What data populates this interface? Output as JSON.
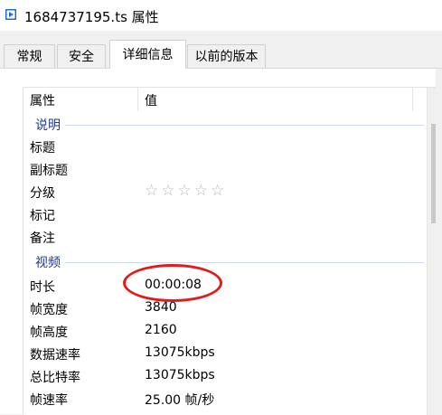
{
  "window": {
    "title": "1684737195.ts 属性",
    "icon": "video-file-icon"
  },
  "tabs": [
    {
      "label": "常规",
      "active": false
    },
    {
      "label": "安全",
      "active": false
    },
    {
      "label": "详细信息",
      "active": true
    },
    {
      "label": "以前的版本",
      "active": false
    }
  ],
  "details": {
    "columns": {
      "property": "属性",
      "value": "值"
    },
    "groups": {
      "description": {
        "label": "说明",
        "rows": [
          {
            "key": "标题",
            "value": ""
          },
          {
            "key": "副标题",
            "value": ""
          },
          {
            "key": "分级",
            "value": "",
            "stars": 0,
            "max_stars": 5
          },
          {
            "key": "标记",
            "value": ""
          },
          {
            "key": "备注",
            "value": ""
          }
        ]
      },
      "video": {
        "label": "视频",
        "rows": [
          {
            "key": "时长",
            "value": "00:00:08"
          },
          {
            "key": "帧宽度",
            "value": "3840"
          },
          {
            "key": "帧高度",
            "value": "2160"
          },
          {
            "key": "数据速率",
            "value": "13075kbps"
          },
          {
            "key": "总比特率",
            "value": "13075kbps"
          },
          {
            "key": "帧速率",
            "value": "25.00 帧/秒"
          }
        ]
      }
    }
  },
  "colors": {
    "accent": "#1e3a8a",
    "annotation": "#e41b1b"
  }
}
